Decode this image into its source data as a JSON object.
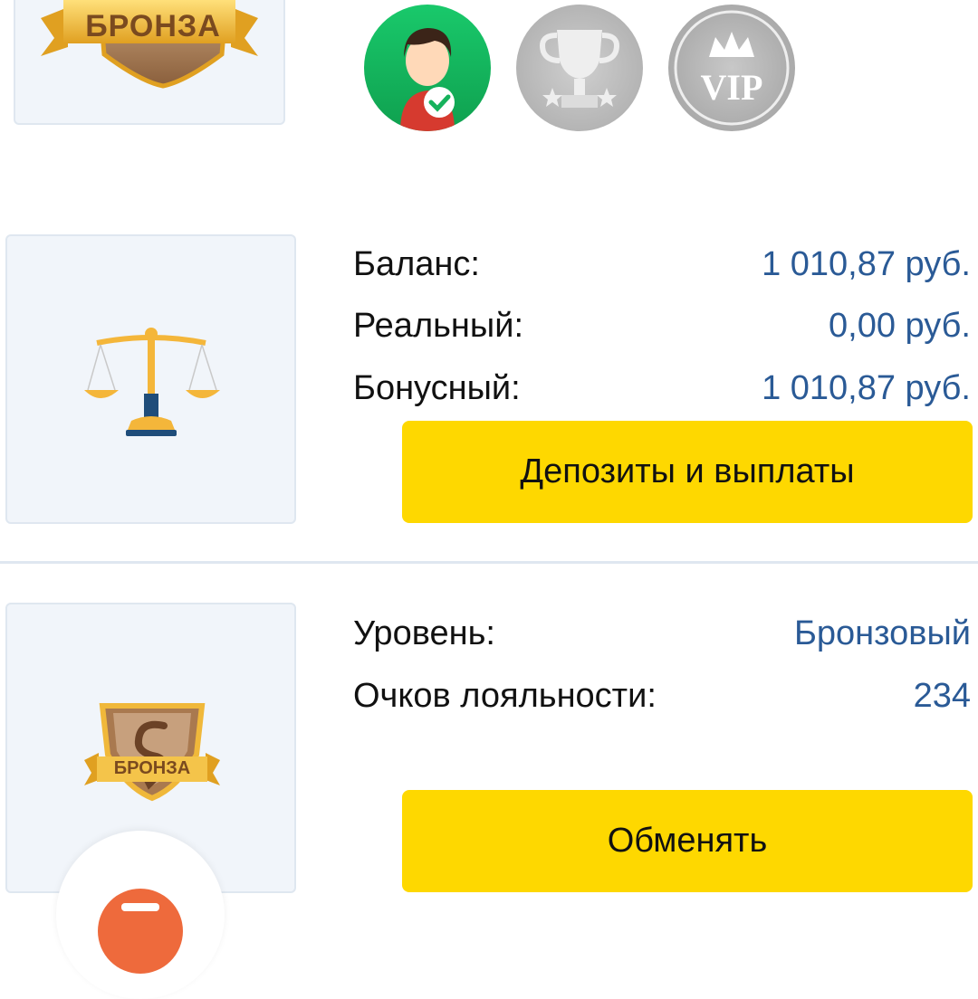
{
  "top": {
    "level_badge_text": "БРОНЗА",
    "achievements": [
      {
        "icon": "verified-user-icon",
        "active": true
      },
      {
        "icon": "trophy-icon",
        "active": false
      },
      {
        "icon": "vip-crown-icon",
        "active": false,
        "text": "VIP"
      }
    ]
  },
  "balance": {
    "icon": "scales-icon",
    "rows": [
      {
        "label": "Баланс:",
        "value": "1 010,87 руб."
      },
      {
        "label": "Реальный:",
        "value": "0,00 руб."
      },
      {
        "label": "Бонусный:",
        "value": "1 010,87 руб."
      }
    ],
    "button_label": "Депозиты и выплаты"
  },
  "loyalty": {
    "icon": "bronze-shield-icon",
    "badge_text": "БРОНЗА",
    "rows": [
      {
        "label": "Уровень:",
        "value": "Бронзовый"
      },
      {
        "label": "Очков лояльности:",
        "value": "234"
      }
    ],
    "button_label": "Обменять"
  },
  "colors": {
    "accent_yellow": "#fed800",
    "value_blue": "#2a5a96",
    "tile_bg": "#f1f5fa",
    "chat_fab": "#ee6a3c"
  },
  "fab": {
    "icon": "chat-minimize-icon"
  }
}
